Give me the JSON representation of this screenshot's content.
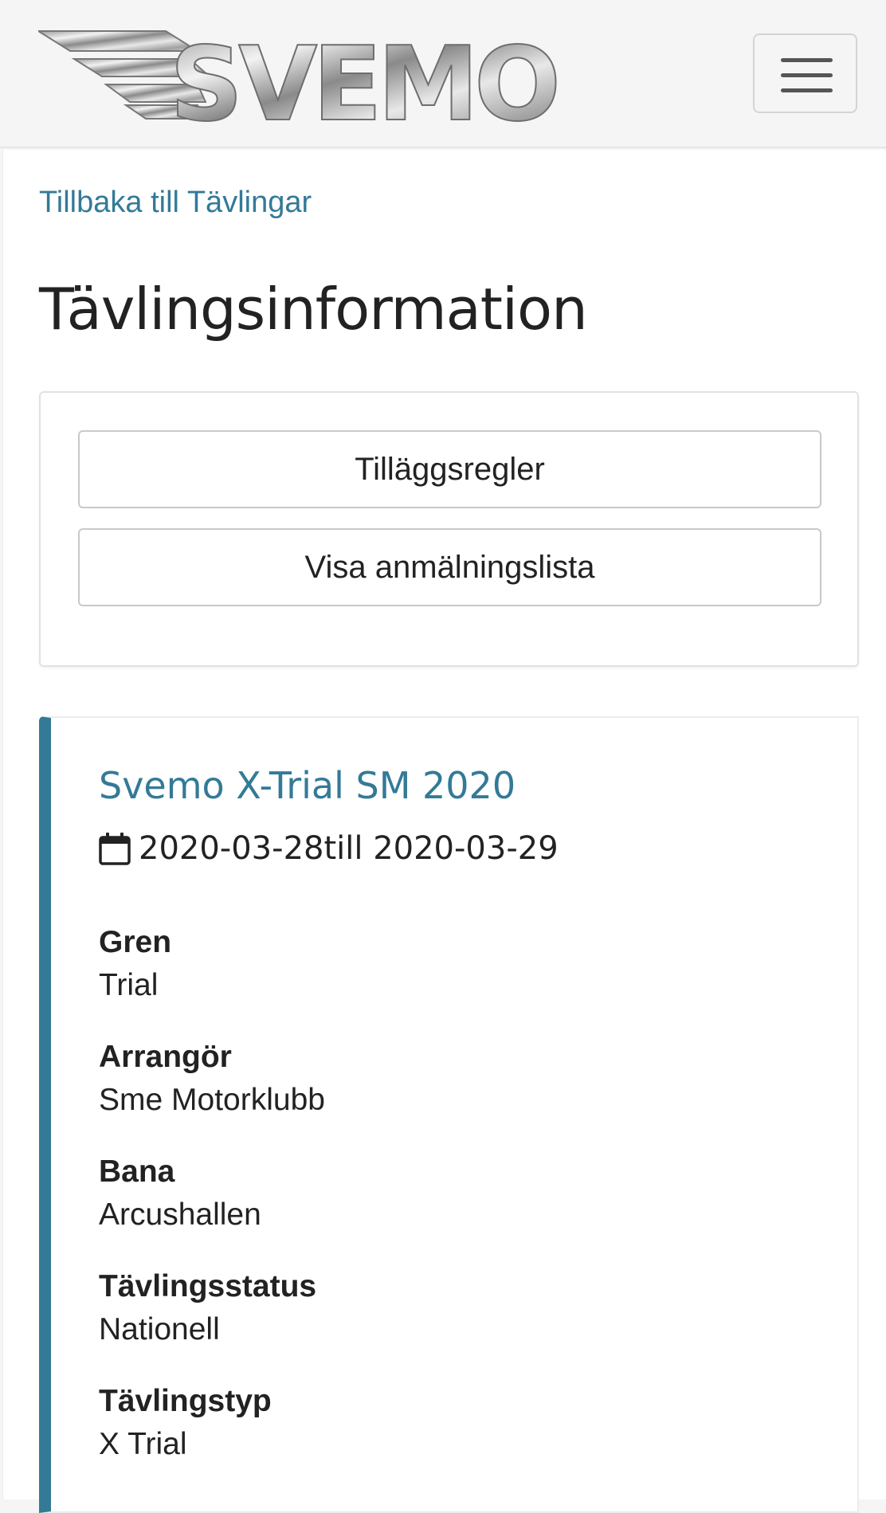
{
  "header": {
    "logo_text": "SVEMO",
    "menu_icon": "hamburger-menu-icon"
  },
  "nav": {
    "back_link": "Tillbaka till Tävlingar"
  },
  "page": {
    "title": "Tävlingsinformation"
  },
  "actions": {
    "rules_button": "Tilläggsregler",
    "entries_button": "Visa anmälningslista"
  },
  "event": {
    "title": "Svemo X-Trial SM 2020",
    "date_icon": "calendar-icon",
    "date_range": "2020-03-28till 2020-03-29",
    "fields": [
      {
        "label": "Gren",
        "value": "Trial"
      },
      {
        "label": "Arrangör",
        "value": "Sme Motorklubb"
      },
      {
        "label": "Bana",
        "value": "Arcushallen"
      },
      {
        "label": "Tävlingsstatus",
        "value": "Nationell"
      },
      {
        "label": "Tävlingstyp",
        "value": "X Trial"
      }
    ],
    "accent_color": "#337a97"
  },
  "colors": {
    "link": "#337a97",
    "background": "#f5f5f5"
  }
}
